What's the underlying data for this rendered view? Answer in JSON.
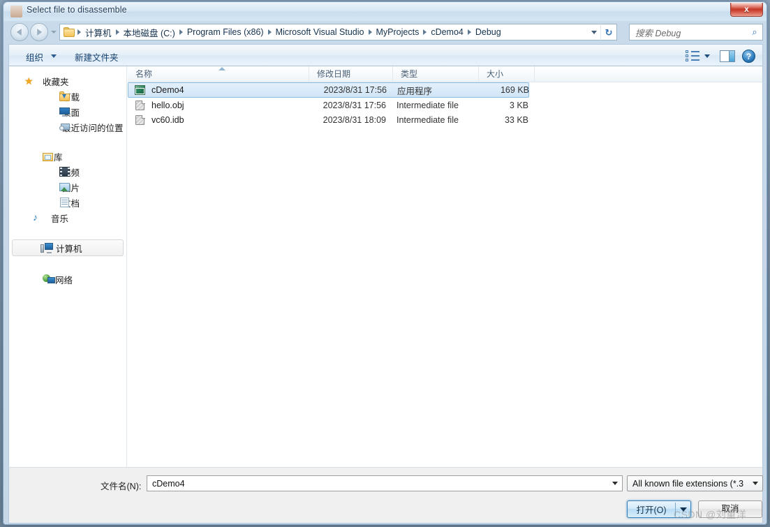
{
  "window": {
    "title": "Select file to disassemble",
    "close_label": "x",
    "icon": "avatar-icon"
  },
  "navbar": {
    "back_icon": "back-arrow-icon",
    "forward_icon": "forward-arrow-icon",
    "history_icon": "chevron-down-icon",
    "folder_icon": "folder-icon",
    "breadcrumbs": [
      "计算机",
      "本地磁盘 (C:)",
      "Program Files (x86)",
      "Microsoft Visual Studio",
      "MyProjects",
      "cDemo4",
      "Debug"
    ],
    "dropdown_icon": "chevron-down-icon",
    "refresh_icon": "refresh-icon",
    "refresh_glyph": "↻",
    "search_placeholder": "搜索 Debug",
    "search_icon": "search-icon",
    "search_glyph": "⌕"
  },
  "toolbar": {
    "organize_label": "组织",
    "new_folder_label": "新建文件夹",
    "views_icon": "view-list-icon",
    "preview_pane_icon": "preview-pane-icon",
    "help_icon": "help-icon",
    "help_glyph": "?"
  },
  "sidebar": {
    "groups": [
      {
        "header": {
          "label": "收藏夹",
          "icon": "star-icon",
          "glyph": "★"
        },
        "items": [
          {
            "label": "下载",
            "icon": "downloads-folder-icon"
          },
          {
            "label": "桌面",
            "icon": "desktop-icon"
          },
          {
            "label": "最近访问的位置",
            "icon": "recent-places-icon"
          }
        ]
      },
      {
        "header": {
          "label": "库",
          "icon": "library-icon"
        },
        "items": [
          {
            "label": "视频",
            "icon": "video-icon"
          },
          {
            "label": "图片",
            "icon": "pictures-icon"
          },
          {
            "label": "文档",
            "icon": "documents-icon"
          },
          {
            "label": "音乐",
            "icon": "music-icon",
            "glyph": "♪"
          }
        ]
      },
      {
        "header": {
          "label": "计算机",
          "icon": "computer-icon",
          "selected": true
        },
        "items": []
      },
      {
        "header": {
          "label": "网络",
          "icon": "network-icon"
        },
        "items": []
      }
    ]
  },
  "filelist": {
    "columns": [
      {
        "label": "名称",
        "sorted": true,
        "sort_icon": "sort-ascending-icon"
      },
      {
        "label": "修改日期"
      },
      {
        "label": "类型"
      },
      {
        "label": "大小"
      }
    ],
    "rows": [
      {
        "name": "cDemo4",
        "date": "2023/8/31 17:56",
        "type": "应用程序",
        "size": "169 KB",
        "icon": "application-file-icon",
        "selected": true
      },
      {
        "name": "hello.obj",
        "date": "2023/8/31 17:56",
        "type": "Intermediate file",
        "size": "3 KB",
        "icon": "unknown-file-icon",
        "selected": false
      },
      {
        "name": "vc60.idb",
        "date": "2023/8/31 18:09",
        "type": "Intermediate file",
        "size": "33 KB",
        "icon": "unknown-file-icon",
        "selected": false
      }
    ]
  },
  "bottom": {
    "filename_label": "文件名(N):",
    "filename_value": "cDemo4",
    "filename_dropdown_icon": "chevron-down-icon",
    "filter_value": "All known file extensions (*.3",
    "filter_dropdown_icon": "chevron-down-icon",
    "open_label": "打开(O)",
    "open_caret_icon": "chevron-down-icon",
    "cancel_label": "取消"
  },
  "watermark": "CSDN @刘重洋",
  "colors": {
    "accent": "#3c7fb1",
    "selection": "#cfe5f7",
    "close_button": "#c5392a",
    "frame": "#cddeee"
  }
}
